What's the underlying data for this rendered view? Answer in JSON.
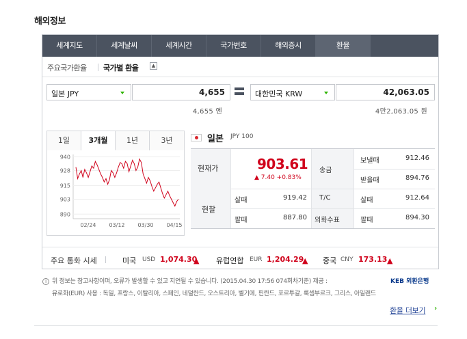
{
  "section_title": "해외정보",
  "tabs": [
    {
      "label": "세계지도"
    },
    {
      "label": "세계날씨"
    },
    {
      "label": "세계시간"
    },
    {
      "label": "국가번호"
    },
    {
      "label": "해외증시"
    },
    {
      "label": "환율"
    }
  ],
  "subnav": {
    "item1": "주요국가환율",
    "item2": "국가별 환율",
    "toggle": "▲"
  },
  "converter": {
    "from_currency": "일본 JPY",
    "from_amount": "4,655",
    "from_korean": "4,655 엔",
    "to_currency": "대한민국 KRW",
    "to_amount": "42,063.05",
    "to_korean": "4만2,063.05 원"
  },
  "period_tabs": [
    "1일",
    "3개월",
    "1년",
    "3년"
  ],
  "chart_data": {
    "type": "line",
    "x": [
      "02/24",
      "03/12",
      "03/30",
      "04/15"
    ],
    "yticks": [
      940,
      928,
      915,
      903,
      890
    ],
    "ylim": [
      886,
      942
    ],
    "series": [
      {
        "values": [
          931,
          921,
          925,
          928,
          922,
          929,
          926,
          922,
          927,
          932,
          930,
          936,
          933,
          929,
          925,
          922,
          918,
          921,
          916,
          920,
          928,
          926,
          922,
          926,
          931,
          935,
          934,
          930,
          936,
          934,
          927,
          932,
          937,
          934,
          928,
          931,
          938,
          935,
          925,
          921,
          917,
          922,
          919,
          914,
          910,
          913,
          916,
          918,
          913,
          908,
          904,
          907,
          910,
          906,
          903,
          900,
          897,
          901,
          903
        ]
      }
    ],
    "color": "#d0021b"
  },
  "country": {
    "name": "일본",
    "code": "JPY 100"
  },
  "rates": {
    "current_label": "현재가",
    "current_value": "903.61",
    "change": "▲ 7.40 +0.83%",
    "cash_label": "현찰",
    "buy_label": "살때",
    "sell_label": "팔때",
    "cash_buy": "919.42",
    "cash_sell": "887.80",
    "remit_label": "송금",
    "send_label": "보낼때",
    "receive_label": "받을때",
    "remit_send": "912.46",
    "remit_receive": "894.76",
    "tc_label": "T/C",
    "tc_buy": "912.64",
    "check_label": "외화수표",
    "check_sell": "894.30"
  },
  "major": {
    "title": "주요 통화 시세",
    "items": [
      {
        "country": "미국",
        "code": "USD",
        "value": "1,074.30",
        "arrow": "▲"
      },
      {
        "country": "유럽연합",
        "code": "EUR",
        "value": "1,204.29",
        "arrow": "▲"
      },
      {
        "country": "중국",
        "code": "CNY",
        "value": "173.13",
        "arrow": "▲"
      }
    ]
  },
  "notice": {
    "icon": "i",
    "line1": "위 정보는 참고사항이며, 오류가 발생할 수 있고 지연될 수 있습니다. (2015.04.30 17:56 074회차기준)   제공 :",
    "provider": "KEB 외환은행",
    "line2": "유로화(EUR) 사용 : 독일, 프랑스, 이탈리아, 스페인, 네덜란드, 오스트리아, 벨기에, 핀란드, 포르투갈, 룩셈부르크, 그리스, 아일랜드"
  },
  "more_link": "환율 더보기",
  "more_arrow": "›"
}
